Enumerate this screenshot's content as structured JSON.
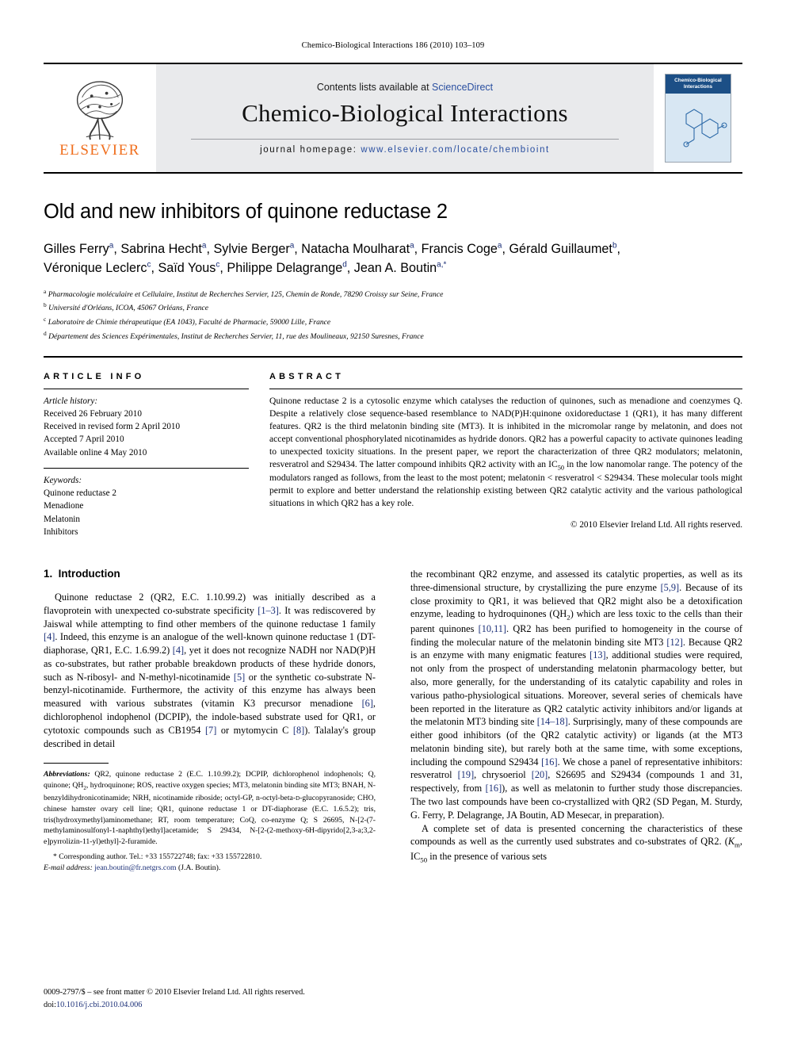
{
  "running_head": "Chemico-Biological Interactions 186 (2010) 103–109",
  "masthead": {
    "contents_prefix": "Contents lists available at ",
    "sciencedirect": "ScienceDirect",
    "journal_title": "Chemico-Biological Interactions",
    "homepage_label": "journal homepage:",
    "homepage_url": "www.elsevier.com/locate/chembioint",
    "publisher_word": "ELSEVIER",
    "cover_title": "Chemico-Biological Interactions",
    "accent_orange": "#f06f1e",
    "link_blue": "#2a4fa0"
  },
  "article": {
    "title": "Old and new inhibitors of quinone reductase 2",
    "authors": [
      {
        "name": "Gilles Ferry",
        "sup": "a"
      },
      {
        "name": "Sabrina Hecht",
        "sup": "a"
      },
      {
        "name": "Sylvie Berger",
        "sup": "a"
      },
      {
        "name": "Natacha Moulharat",
        "sup": "a"
      },
      {
        "name": "Francis Coge",
        "sup": "a"
      },
      {
        "name": "Gérald Guillaumet",
        "sup": "b"
      },
      {
        "name": "Véronique Leclerc",
        "sup": "c"
      },
      {
        "name": "Saïd Yous",
        "sup": "c"
      },
      {
        "name": "Philippe Delagrange",
        "sup": "d"
      },
      {
        "name": "Jean A. Boutin",
        "sup": "a,*"
      }
    ],
    "affiliations": [
      {
        "mark": "a",
        "text": "Pharmacologie moléculaire et Cellulaire, Institut de Recherches Servier, 125, Chemin de Ronde, 78290 Croissy sur Seine, France"
      },
      {
        "mark": "b",
        "text": "Université d'Orléans, ICOA, 45067 Orléans, France"
      },
      {
        "mark": "c",
        "text": "Laboratoire de Chimie thérapeutique (EA 1043), Faculté de Pharmacie, 59000 Lille, France"
      },
      {
        "mark": "d",
        "text": "Département des Sciences Expérimentales, Institut de Recherches Servier, 11, rue des Moulineaux, 92150 Suresnes, France"
      }
    ]
  },
  "article_info": {
    "heading": "ARTICLE INFO",
    "history_label": "Article history:",
    "history": [
      "Received 26 February 2010",
      "Received in revised form 2 April 2010",
      "Accepted 7 April 2010",
      "Available online 4 May 2010"
    ],
    "keywords_label": "Keywords:",
    "keywords": [
      "Quinone reductase 2",
      "Menadione",
      "Melatonin",
      "Inhibitors"
    ]
  },
  "abstract": {
    "heading": "ABSTRACT",
    "text": "Quinone reductase 2 is a cytosolic enzyme which catalyses the reduction of quinones, such as menadione and coenzymes Q. Despite a relatively close sequence-based resemblance to NAD(P)H:quinone oxidoreductase 1 (QR1), it has many different features. QR2 is the third melatonin binding site (MT3). It is inhibited in the micromolar range by melatonin, and does not accept conventional phosphorylated nicotinamides as hydride donors. QR2 has a powerful capacity to activate quinones leading to unexpected toxicity situations. In the present paper, we report the characterization of three QR2 modulators; melatonin, resveratrol and S29434. The latter compound inhibits QR2 activity with an IC50 in the low nanomolar range. The potency of the modulators ranged as follows, from the least to the most potent; melatonin < resveratrol < S29434. These molecular tools might permit to explore and better understand the relationship existing between QR2 catalytic activity and the various pathological situations in which QR2 has a key role.",
    "copyright": "© 2010 Elsevier Ireland Ltd. All rights reserved."
  },
  "introduction": {
    "section_number": "1.",
    "section_title": "Introduction",
    "paragraph_1": "Quinone reductase 2 (QR2, E.C. 1.10.99.2) was initially described as a flavoprotein with unexpected co-substrate specificity [1–3]. It was rediscovered by Jaiswal while attempting to find other members of the quinone reductase 1 family [4]. Indeed, this enzyme is an analogue of the well-known quinone reductase 1 (DT-diaphorase, QR1, E.C. 1.6.99.2) [4], yet it does not recognize NADH nor NAD(P)H as co-substrates, but rather probable breakdown products of these hydride donors, such as N-ribosyl- and N-methyl-nicotinamide [5] or the synthetic co-substrate N-benzyl-nicotinamide. Furthermore, the activity of this enzyme has always been measured with various substrates (vitamin K3 precursor menadione [6], dichlorophenol indophenol (DCPIP), the indole-based substrate used for QR1, or cytotoxic compounds such as CB1954 [7] or mytomycin C [8]). Talalay's group described in detail",
    "paragraph_2": "the recombinant QR2 enzyme, and assessed its catalytic properties, as well as its three-dimensional structure, by crystallizing the pure enzyme [5,9]. Because of its close proximity to QR1, it was believed that QR2 might also be a detoxification enzyme, leading to hydroquinones (QH2) which are less toxic to the cells than their parent quinones [10,11]. QR2 has been purified to homogeneity in the course of finding the molecular nature of the melatonin binding site MT3 [12]. Because QR2 is an enzyme with many enigmatic features [13], additional studies were required, not only from the prospect of understanding melatonin pharmacology better, but also, more generally, for the understanding of its catalytic capability and roles in various patho-physiological situations. Moreover, several series of chemicals have been reported in the literature as QR2 catalytic activity inhibitors and/or ligands at the melatonin MT3 binding site [14–18]. Surprisingly, many of these compounds are either good inhibitors (of the QR2 catalytic activity) or ligands (at the MT3 melatonin binding site), but rarely both at the same time, with some exceptions, including the compound S29434 [16]. We chose a panel of representative inhibitors: resveratrol [19], chrysoeriol [20], S26695 and S29434 (compounds 1 and 31, respectively, from [16]), as well as melatonin to further study those discrepancies. The two last compounds have been co-crystallized with QR2 (SD Pegan, M. Sturdy, G. Ferry, P. Delagrange, JA Boutin, AD Mesecar, in preparation).",
    "paragraph_3": "A complete set of data is presented concerning the characteristics of these compounds as well as the currently used substrates and co-substrates of QR2. (Km, IC50 in the presence of various sets"
  },
  "footnote": {
    "label": "Abbreviations:",
    "text": "QR2, quinone reductase 2 (E.C. 1.10.99.2); DCPIP, dichlorophenol indophenols; Q, quinone; QH2, hydroquinone; ROS, reactive oxygen species; MT3, melatonin binding site MT3; BNAH, N-benzyldihydronicotinamide; NRH, nicotinamide riboside; octyl-GP, n-octyl-beta-D-glucopyranoside; CHO, chinese hamster ovary cell line; QR1, quinone reductase 1 or DT-diaphorase (E.C. 1.6.5.2); tris, tris(hydroxymethyl)aminomethane; RT, room temperature; CoQ, co-enzyme Q; S 26695, N-[2-(7-methylaminosulfonyl-1-naphthyl)ethyl]acetamide; S 29434, N-[2-(2-methoxy-6H-dipyrido[2,3-a;3,2-e]pyrrolizin-11-yl)ethyl]-2-furamide.",
    "corresponding": "* Corresponding author. Tel.: +33 155722748; fax: +33 155722810.",
    "email_label": "E-mail address:",
    "email": "jean.boutin@fr.netgrs.com",
    "email_owner": "(J.A. Boutin)."
  },
  "page_footer": {
    "issn_line": "0009-2797/$ – see front matter © 2010 Elsevier Ireland Ltd. All rights reserved.",
    "doi_label": "doi:",
    "doi": "10.1016/j.cbi.2010.04.006"
  }
}
